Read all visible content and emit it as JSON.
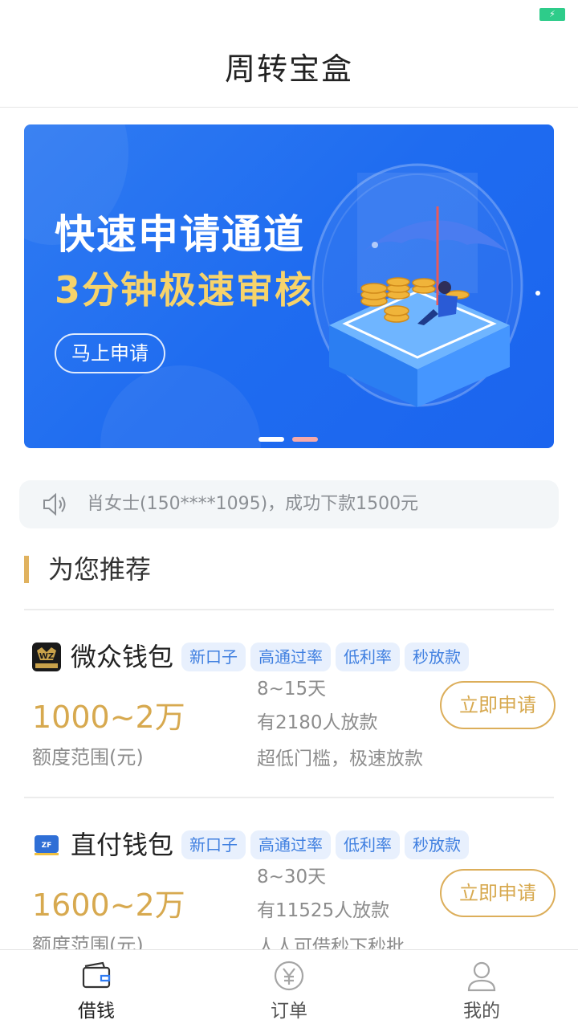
{
  "app": {
    "title": "周转宝盒"
  },
  "banner": {
    "title": "快速申请通道",
    "subtitle": "3分钟极速审核",
    "button_label": "马上申请"
  },
  "notice": {
    "text": "肖女士(150****1095)，成功下款1500元"
  },
  "section": {
    "title": "为您推荐"
  },
  "products": [
    {
      "name": "微众钱包",
      "logo_icon": "wz-wallet-logo",
      "tags": [
        "新口子",
        "高通过率",
        "低利率",
        "秒放款"
      ],
      "amount": "1000~2万",
      "amount_label": "额度范围(元)",
      "term": "8~15天",
      "lent_count": "有2180人放款",
      "slogan": "超低门槛，极速放款",
      "button_label": "立即申请"
    },
    {
      "name": "直付钱包",
      "logo_icon": "zf-wallet-logo",
      "tags": [
        "新口子",
        "高通过率",
        "低利率",
        "秒放款"
      ],
      "amount": "1600~2万",
      "amount_label": "额度范围(元)",
      "term": "8~30天",
      "lent_count": "有11525人放款",
      "slogan": "人人可借秒下秒批",
      "button_label": "立即申请"
    }
  ],
  "tabbar": {
    "items": [
      {
        "label": "借钱",
        "icon": "wallet-icon",
        "active": true
      },
      {
        "label": "订单",
        "icon": "yen-coin-icon",
        "active": false
      },
      {
        "label": "我的",
        "icon": "person-icon",
        "active": false
      }
    ]
  },
  "colors": {
    "brand_blue": "#1f6cf0",
    "gold": "#d7a94f",
    "tag_bg": "#e8f0fd",
    "tag_text": "#3f7fe0"
  }
}
